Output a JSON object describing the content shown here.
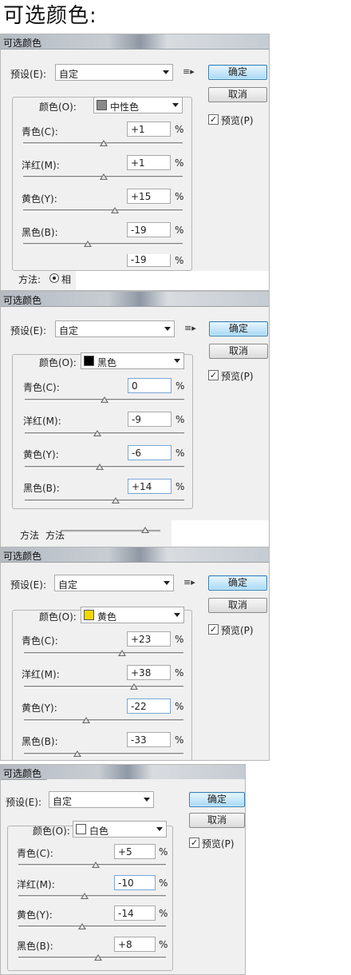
{
  "heading": "可选颜色:",
  "panels": [
    {
      "title": "可选颜色",
      "preset_label": "预设(E):",
      "preset_value": "自定",
      "ok": "确定",
      "cancel": "取消",
      "preview": "预览(P)",
      "colors_label": "颜色(O):",
      "color_name": "中性色",
      "swatch": "#8a8a8a",
      "rows": [
        {
          "label": "青色(C):",
          "value": "+1",
          "pct": "%",
          "level": 0.505
        },
        {
          "label": "洋红(M):",
          "value": "+1",
          "pct": "%",
          "level": 0.505
        },
        {
          "label": "黄色(Y):",
          "value": "+15",
          "pct": "%",
          "level": 0.575
        },
        {
          "label": "黑色(B):",
          "value": "-19",
          "pct": "%",
          "level": 0.405
        }
      ],
      "extra_value": "-19",
      "extra_pct": "%",
      "method_label": "方法:",
      "method_option": "相"
    },
    {
      "title": "可选颜色",
      "preset_label": "预设(E):",
      "preset_value": "自定",
      "ok": "确定",
      "cancel": "取消",
      "preview": "预览(P)",
      "colors_label": "颜色(O):",
      "color_name": "黑色",
      "swatch": "#000000",
      "rows": [
        {
          "label": "青色(C):",
          "value": "0",
          "pct": "%",
          "level": 0.5
        },
        {
          "label": "洋红(M):",
          "value": "-9",
          "pct": "%",
          "level": 0.455
        },
        {
          "label": "黄色(Y):",
          "value": "-6",
          "pct": "%",
          "level": 0.47
        },
        {
          "label": "黑色(B):",
          "value": "+14",
          "pct": "%",
          "level": 0.57
        }
      ],
      "method_label": "方法",
      "method_label_2": "方法"
    },
    {
      "title": "可选颜色",
      "preset_label": "预设(E):",
      "preset_value": "自定",
      "ok": "确定",
      "cancel": "取消",
      "preview": "预览(P)",
      "colors_label": "颜色(O):",
      "color_name": "黄色",
      "swatch": "#f2d800",
      "rows": [
        {
          "label": "青色(C):",
          "value": "+23",
          "pct": "%",
          "level": 0.615
        },
        {
          "label": "洋红(M):",
          "value": "+38",
          "pct": "%",
          "level": 0.69
        },
        {
          "label": "黄色(Y):",
          "value": "-22",
          "pct": "%",
          "level": 0.39
        },
        {
          "label": "黑色(B):",
          "value": "-33",
          "pct": "%",
          "level": 0.335
        }
      ]
    },
    {
      "title": "可选颜色",
      "preset_label": "预设(E):",
      "preset_value": "自定",
      "ok": "确定",
      "cancel": "取消",
      "preview": "预览(P)",
      "colors_label": "颜色(O):",
      "color_name": "白色",
      "swatch": "#ffffff",
      "rows": [
        {
          "label": "青色(C):",
          "value": "+5",
          "pct": "%",
          "level": 0.525
        },
        {
          "label": "洋红(M):",
          "value": "-10",
          "pct": "%",
          "level": 0.45
        },
        {
          "label": "黄色(Y):",
          "value": "-14",
          "pct": "%",
          "level": 0.43
        },
        {
          "label": "黑色(B):",
          "value": "+8",
          "pct": "%",
          "level": 0.54
        }
      ]
    }
  ]
}
